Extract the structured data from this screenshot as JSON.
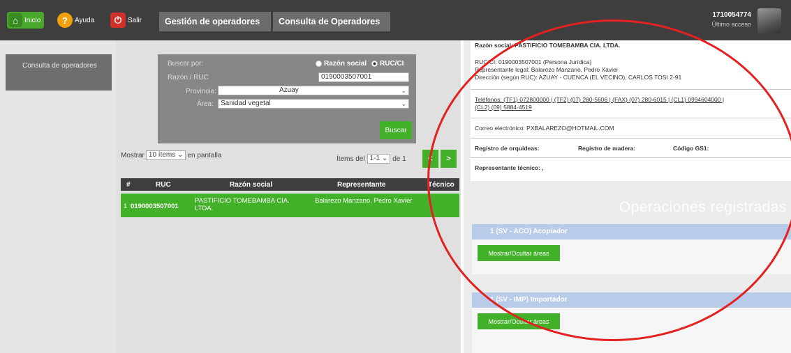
{
  "topbar": {
    "home_label": "Inicio",
    "help_label": "Ayuda",
    "exit_label": "Salir",
    "tab_gestion": "Gestión de operadores",
    "tab_consulta": "Consulta de Operadores",
    "user_id": "1710054774",
    "user_sub": "Último acceso"
  },
  "sidebar": {
    "items": [
      {
        "label": "Consulta de operadores"
      }
    ]
  },
  "search": {
    "buscar_por_label": "Buscar por:",
    "radio_razon": "Razón social",
    "radio_ruc": "RUC/CI",
    "razon_ruc_label": "Razón / RUC",
    "ruc_value": "0190003507001",
    "provincia_label": "Provincia:",
    "provincia_value": "Azuay",
    "area_label": "Área:",
    "area_value": "Sanidad vegetal",
    "buscar_button": "Buscar"
  },
  "pagination": {
    "mostrar_label": "Mostrar",
    "items_value": "10 ítems",
    "en_pantalla": "en pantalla",
    "items_del": "Ítems del",
    "range_value": "1-1",
    "de_label": "de 1",
    "prev": "<",
    "next": ">"
  },
  "table": {
    "headers": [
      "#",
      "RUC",
      "Razón social",
      "Representante",
      "Técnico"
    ],
    "rows": [
      {
        "num": "1",
        "ruc": "0190003507001",
        "razon": "PASTIFICIO TOMEBAMBA CIA. LTDA.",
        "representante": "Balarezo Manzano, Pedro Xavier",
        "tecnico": ""
      }
    ]
  },
  "info": {
    "razon_social": "Razón social: PASTIFICIO TOMEBAMBA CIA. LTDA.",
    "ruc_line": "RUC/CI: 0190003507001 (Persona Jurídica)",
    "representante": "Representante legal: Balarezo Manzano, Pedro Xavier",
    "direccion": "Dirección (según RUC): AZUAY - CUENCA (EL VECINO), CARLOS TOSI 2-91",
    "telefonos1": "Teléfonos: (TF1) 072800000 | (TF2) (07) 280-5606 | (FAX) (07) 280-6015 | (CL1) 0994604000 |",
    "telefonos2": "(CL2) (09) 5884-4519",
    "correo": "Correo electrónico: PXBALAREZO@HOTMAIL.COM",
    "orquideas": "Registro de orquídeas:",
    "madera": "Registro de madera:",
    "gs1": "Código GS1:",
    "tecnico": "Representante técnico: ,"
  },
  "operations": {
    "title": "Operaciones registradas",
    "items": [
      {
        "header": "1 (SV - ACO) Acopiador",
        "button": "Mostrar/Ocultar áreas"
      },
      {
        "header": "1 (SV - IMP) Importador",
        "button": "Mostrar/Ocultar áreas"
      }
    ]
  },
  "colors": {
    "topbar": "#3e3e3e",
    "accent_green": "#43b02a",
    "op_header_blue": "#b8cbe8",
    "annotation_red": "#e32121"
  }
}
